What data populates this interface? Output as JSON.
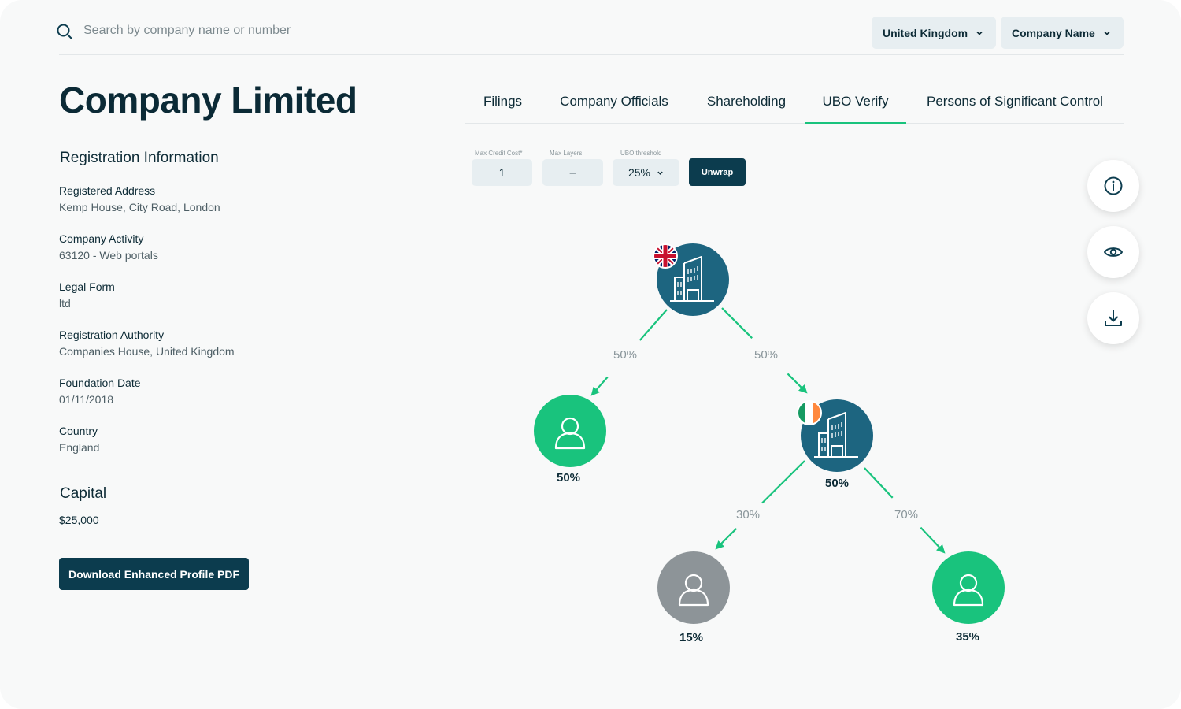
{
  "search": {
    "placeholder": "Search by company name or number"
  },
  "filters": {
    "country": "United Kingdom",
    "search_by": "Company Name"
  },
  "company": {
    "title": "Company Limited"
  },
  "registration": {
    "heading": "Registration Information",
    "fields": [
      {
        "label": "Registered Address",
        "value": "Kemp House, City Road, London"
      },
      {
        "label": "Company Activity",
        "value": "63120 - Web portals"
      },
      {
        "label": "Legal Form",
        "value": "ltd"
      },
      {
        "label": "Registration Authority",
        "value": "Companies House, United Kingdom"
      },
      {
        "label": "Foundation Date",
        "value": "01/11/2018"
      },
      {
        "label": "Country",
        "value": "England"
      }
    ]
  },
  "capital": {
    "heading": "Capital",
    "value": "$25,000"
  },
  "download_pdf_label": "Download Enhanced Profile PDF",
  "tabs": [
    {
      "label": "Filings",
      "active": false
    },
    {
      "label": "Company Officials",
      "active": false
    },
    {
      "label": "Shareholding",
      "active": false
    },
    {
      "label": "UBO Verify",
      "active": true
    },
    {
      "label": "Persons of Significant Control",
      "active": false
    }
  ],
  "controls": {
    "max_credit_cost": {
      "label": "Max Credit Cost*",
      "value": "1"
    },
    "max_layers": {
      "label": "Max Layers",
      "placeholder": "–"
    },
    "ubo_threshold": {
      "label": "UBO threshold",
      "value": "25%"
    },
    "unwrap_label": "Unwrap"
  },
  "side_actions": [
    "info-icon",
    "eye-icon",
    "download-icon"
  ],
  "ownership_tree": {
    "root": {
      "type": "company",
      "flag": "United Kingdom"
    },
    "edges": [
      {
        "from": "root",
        "to": "person-1",
        "share": "50%"
      },
      {
        "from": "root",
        "to": "company-ie",
        "share": "50%"
      },
      {
        "from": "company-ie",
        "to": "person-2",
        "share": "30%"
      },
      {
        "from": "company-ie",
        "to": "person-3",
        "share": "70%"
      }
    ],
    "nodes": [
      {
        "id": "person-1",
        "type": "person",
        "status": "ubo",
        "effective": "50%"
      },
      {
        "id": "company-ie",
        "type": "company",
        "flag": "Ireland",
        "effective": "50%"
      },
      {
        "id": "person-2",
        "type": "person",
        "status": "below-threshold",
        "effective": "15%"
      },
      {
        "id": "person-3",
        "type": "person",
        "status": "ubo",
        "effective": "35%"
      }
    ]
  },
  "colors": {
    "primary_dark": "#0c3c4e",
    "company_node": "#1d6580",
    "ubo_green": "#19c37d",
    "below_threshold_gray": "#8d9498"
  }
}
